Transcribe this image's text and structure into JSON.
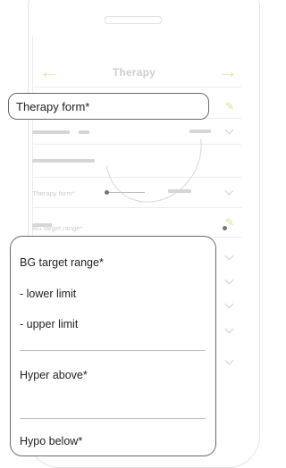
{
  "header": {
    "back_icon": "arrow-left-icon",
    "forward_icon": "arrow-right-icon",
    "title": "Therapy"
  },
  "form": {
    "therapy_form_label": "Therapy form*",
    "bg_target_range_label": "BG target range*"
  },
  "callout_top": {
    "label": "Therapy form*"
  },
  "callout_bottom": {
    "title": "BG target range*",
    "lower_limit": "- lower limit",
    "upper_limit": "- upper limit",
    "hyper_above": "Hyper above*",
    "hypo_below": "Hypo below*"
  },
  "colors": {
    "accent": "#ede3a4",
    "border": "#6a6a6a"
  }
}
